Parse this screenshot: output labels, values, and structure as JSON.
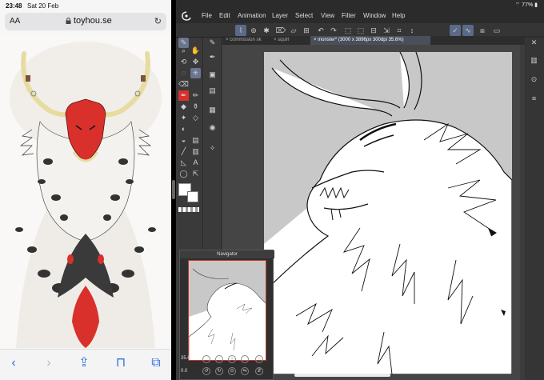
{
  "safari": {
    "time": "23:48",
    "date": "Sat 20 Feb",
    "aa": "AA",
    "url": "toyhou.se",
    "toolbar": {
      "back": "‹",
      "forward": "›",
      "share": "⇪",
      "bookmarks": "⊓",
      "tabs": "⧉"
    }
  },
  "ios": {
    "status": "⌔ 77% ▮"
  },
  "csp": {
    "menu": [
      "File",
      "Edit",
      "Animation",
      "Layer",
      "Select",
      "View",
      "Filter",
      "Window",
      "Help"
    ],
    "tabs": [
      {
        "label": "commission sk",
        "active": false
      },
      {
        "label": "squirl",
        "active": false
      },
      {
        "label": "monster* (3000 x 3896px 300dpi 35.6%)",
        "active": true
      }
    ],
    "navigator": {
      "title": "Navigator",
      "zoom": "35.6",
      "rotation": "0.0"
    },
    "colors": {
      "main": "#ffffff",
      "sub": "#ffffff",
      "accent_red": "#d9302b"
    }
  }
}
